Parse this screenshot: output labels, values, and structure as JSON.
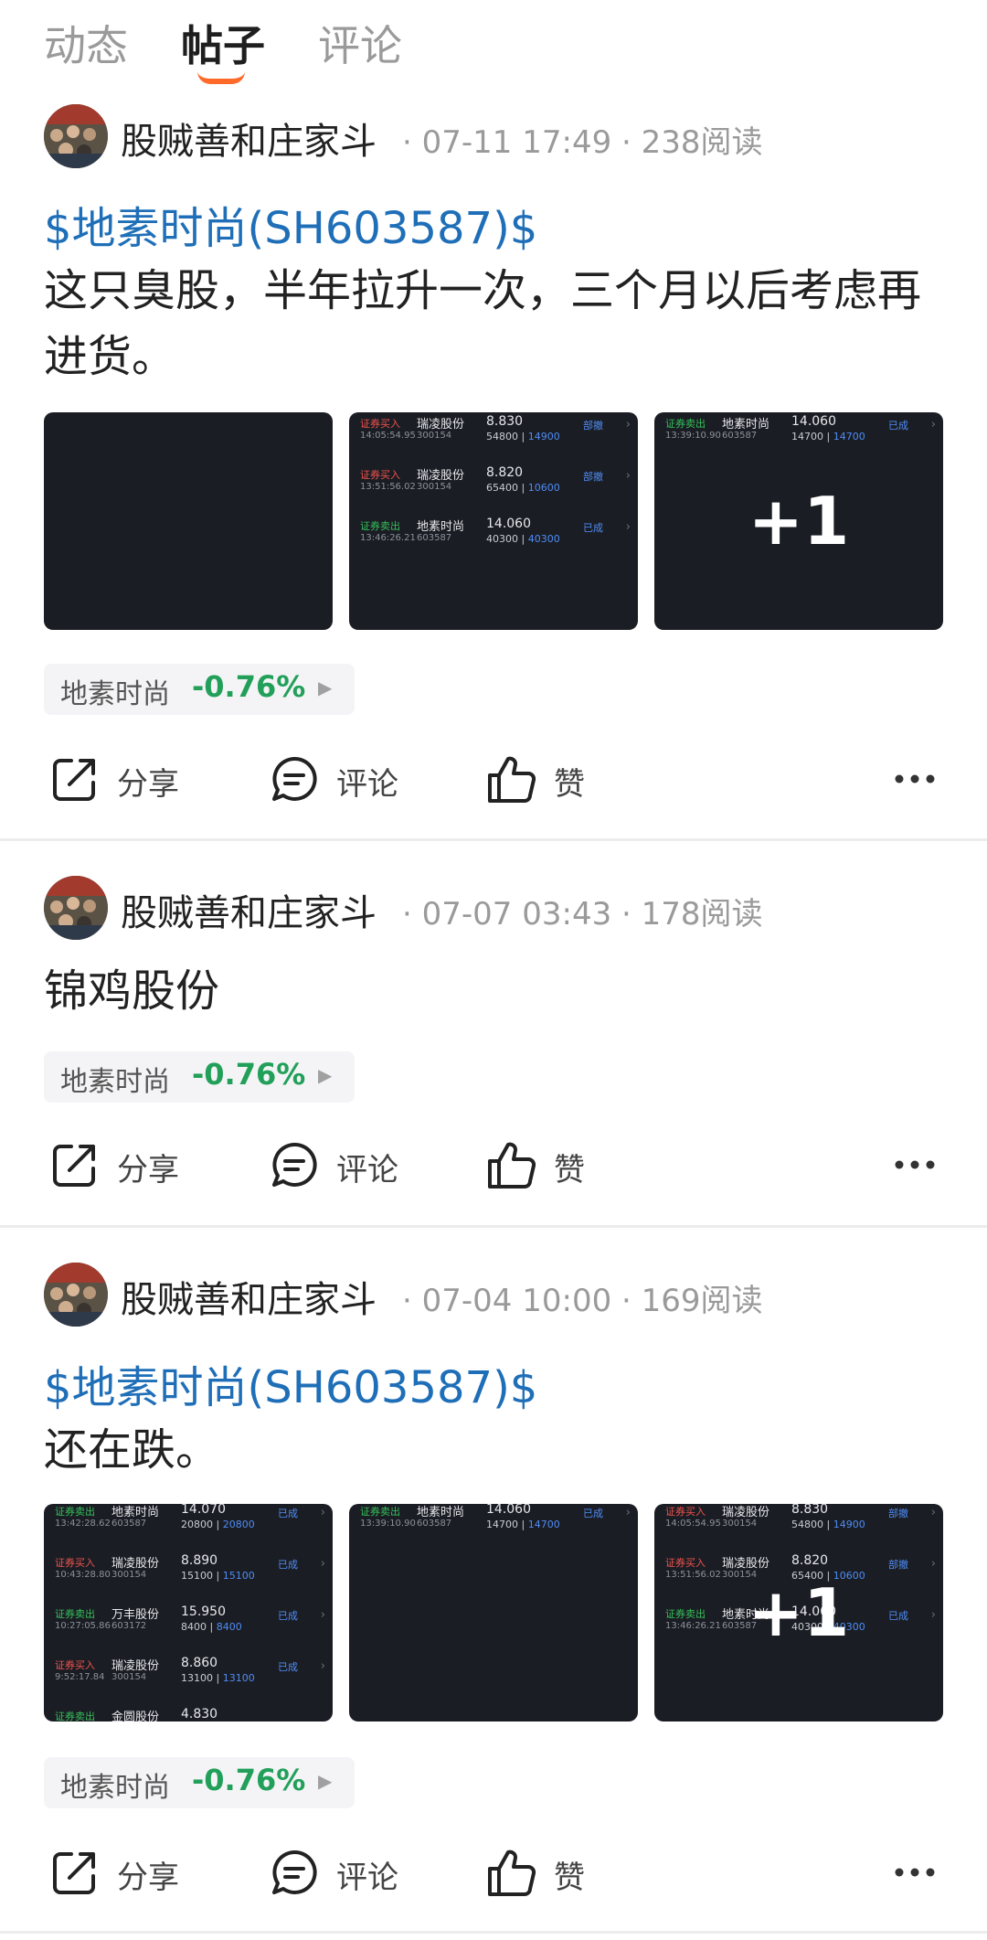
{
  "tabs": [
    {
      "label": "动态",
      "active": false
    },
    {
      "label": "帖子",
      "active": true
    },
    {
      "label": "评论",
      "active": false
    }
  ],
  "actions": {
    "share": "分享",
    "comment": "评论",
    "like": "赞"
  },
  "stock_tag": {
    "name": "地素时尚",
    "change": "-0.76%",
    "color": "#22a05a"
  },
  "thumb_overlay": "+1",
  "posts": [
    {
      "author": "股贼善和庄家斗",
      "date": "07-11 17:49",
      "reads": "238阅读",
      "topic": "$地素时尚(SH603587)$",
      "text": "这只臭股，半年拉升一次，三个月以后考虑再进货。",
      "thumb2": [
        {
          "type": "证券买入",
          "time": "14:05:54.95",
          "name": "瑞凌股份",
          "code": "300154",
          "price": "8.830",
          "qty": "54800",
          "qty2": "14900",
          "status": "部撤"
        },
        {
          "type": "证券买入",
          "time": "13:51:56.02",
          "name": "瑞凌股份",
          "code": "300154",
          "price": "8.820",
          "qty": "65400",
          "qty2": "10600",
          "status": "部撤"
        },
        {
          "type": "证券卖出",
          "time": "13:46:26.21",
          "name": "地素时尚",
          "code": "603587",
          "price": "14.060",
          "qty": "40300",
          "qty2": "40300",
          "status": "已成"
        }
      ],
      "thumb3": {
        "type": "证券卖出",
        "time": "13:39:10.90",
        "name": "地素时尚",
        "code": "603587",
        "price": "14.060",
        "qty": "14700",
        "qty2": "14700",
        "status": "已成"
      }
    },
    {
      "author": "股贼善和庄家斗",
      "date": "07-07 03:43",
      "reads": "178阅读",
      "text": "锦鸡股份"
    },
    {
      "author": "股贼善和庄家斗",
      "date": "07-04 10:00",
      "reads": "169阅读",
      "topic": "$地素时尚(SH603587)$",
      "text": "还在跌。",
      "thumb1": [
        {
          "type": "证券卖出",
          "time": "13:42:28.62",
          "name": "地素时尚",
          "code": "603587",
          "price": "14.070",
          "qty": "20800",
          "qty2": "20800",
          "status": "已成"
        },
        {
          "type": "证券买入",
          "time": "10:43:28.80",
          "name": "瑞凌股份",
          "code": "300154",
          "price": "8.890",
          "qty": "15100",
          "qty2": "15100",
          "status": "已成"
        },
        {
          "type": "证券卖出",
          "time": "10:27:05.86",
          "name": "万丰股份",
          "code": "603172",
          "price": "15.950",
          "qty": "8400",
          "qty2": "8400",
          "status": "已成"
        },
        {
          "type": "证券买入",
          "time": "9:52:17.84",
          "name": "瑞凌股份",
          "code": "300154",
          "price": "8.860",
          "qty": "13100",
          "qty2": "13100",
          "status": "已成"
        },
        {
          "type": "证券卖出",
          "time": "",
          "name": "金圆股份",
          "code": "",
          "price": "4.830",
          "qty": "",
          "qty2": "",
          "status": ""
        }
      ],
      "thumb2": {
        "type": "证券卖出",
        "time": "13:39:10.90",
        "name": "地素时尚",
        "code": "603587",
        "price": "14.060",
        "qty": "14700",
        "qty2": "14700",
        "status": "已成"
      },
      "thumb3": [
        {
          "type": "证券买入",
          "time": "14:05:54.95",
          "name": "瑞凌股份",
          "code": "300154",
          "price": "8.830",
          "qty": "54800",
          "qty2": "14900",
          "status": "部撤"
        },
        {
          "type": "证券买入",
          "time": "13:51:56.02",
          "name": "瑞凌股份",
          "code": "300154",
          "price": "8.820",
          "qty": "65400",
          "qty2": "10600",
          "status": "部撤"
        },
        {
          "type": "证券卖出",
          "time": "13:46:26.21",
          "name": "地素时尚",
          "code": "603587",
          "price": "14.060",
          "qty": "40300",
          "qty2": "40300",
          "status": "已成"
        }
      ]
    }
  ]
}
